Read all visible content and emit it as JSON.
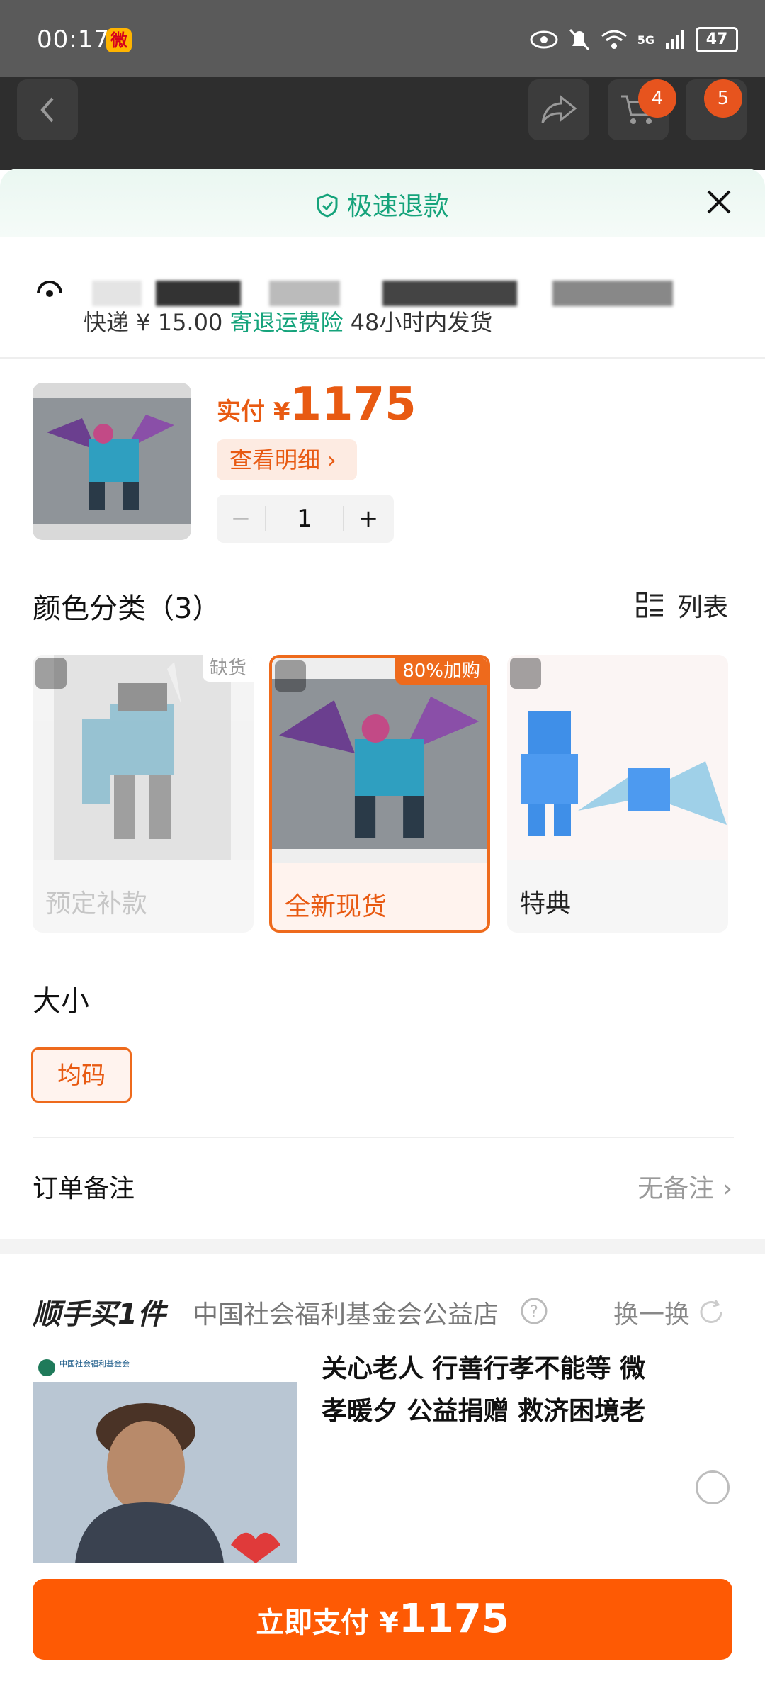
{
  "status_bar": {
    "time": "00:17",
    "battery": "47",
    "network": "5G"
  },
  "nav": {
    "cart_badge": "4",
    "message_badge": "5"
  },
  "sheet": {
    "banner": "极速退款",
    "shipping": {
      "fee_text": "快递 ¥ 15.00",
      "insurance": "寄退运费险",
      "dispatch": "48小时内发货"
    }
  },
  "product": {
    "price_label": "实付 ¥",
    "price": "1175",
    "detail_button": "查看明细 ›",
    "quantity": "1",
    "minus": "−",
    "plus": "+"
  },
  "color_section": {
    "title": "颜色分类（3）",
    "list_toggle": "列表",
    "options": [
      {
        "label": "预定补款",
        "tag": "缺货",
        "selected": false,
        "disabled": true
      },
      {
        "label": "全新现货",
        "tag": "80%加购",
        "selected": true,
        "disabled": false
      },
      {
        "label": "特典",
        "tag": "",
        "selected": false,
        "disabled": false
      }
    ]
  },
  "size_section": {
    "title": "大小",
    "option": "均码"
  },
  "order_note": {
    "label": "订单备注",
    "value": "无备注 ›"
  },
  "buy_one": {
    "title": "顺手买1件",
    "shop": "中国社会福利基金会公益店",
    "swap": "换一换",
    "item_title": "关心老人 行善行孝不能等 微孝暖夕 公益捐赠 救济困境老",
    "logo_text": "中国社会福利基金会"
  },
  "pay_button": {
    "label": "立即支付 ¥",
    "amount": "1175"
  },
  "colors": {
    "accent": "#fe5a04",
    "green": "#15a37b",
    "status_bar": "#5a5a5a"
  }
}
